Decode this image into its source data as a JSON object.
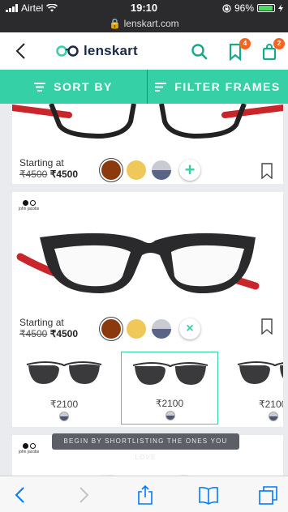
{
  "status": {
    "carrier": "Airtel",
    "time": "19:10",
    "url": "lenskart.com",
    "battery": "96%"
  },
  "header": {
    "brand": "lenskart",
    "wishlist_count": "4",
    "cart_count": "2"
  },
  "sortbar": {
    "sort_label": "SORT BY",
    "filter_label": "FILTER FRAMES"
  },
  "products": [
    {
      "starting_label": "Starting at",
      "old_price": "₹4500",
      "price": "₹4500",
      "swatches": [
        "#8b3a0e",
        "#f0c85a",
        "#5a6585"
      ],
      "action": "+"
    },
    {
      "brand_name": "john jacobs",
      "starting_label": "Starting at",
      "old_price": "₹4500",
      "price": "₹4500",
      "swatches": [
        "#8b3a0e",
        "#f0c85a",
        "#5a6585"
      ],
      "action": "×"
    }
  ],
  "similar": [
    {
      "price": "₹2100"
    },
    {
      "price": "₹2100"
    },
    {
      "price": "₹2100"
    }
  ],
  "next_brand": "john jacobs",
  "toast": "BEGIN BY SHORTLISTING THE ONES YOU LOVE",
  "colors": {
    "accent": "#35d0a5",
    "badge": "#f26522",
    "ios_blue": "#007aff"
  }
}
